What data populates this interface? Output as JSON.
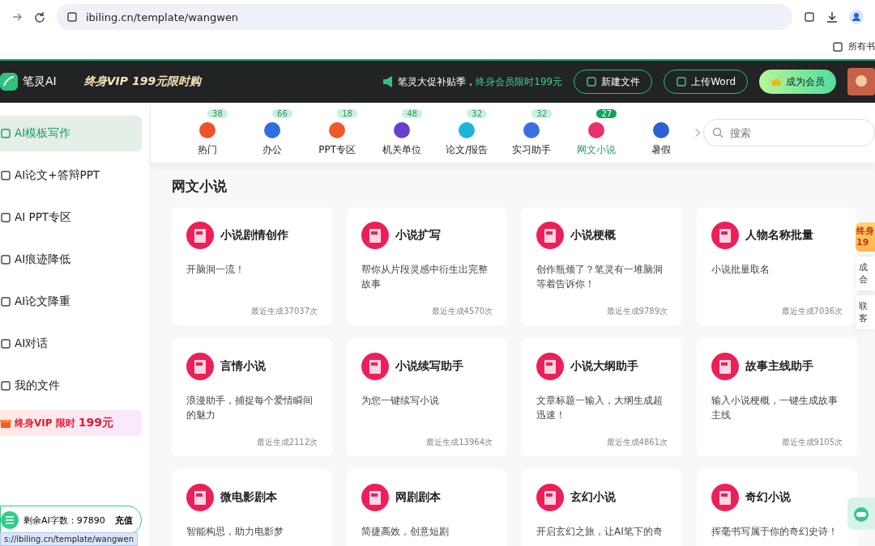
{
  "browser": {
    "url": "ibiling.cn/template/wangwen",
    "bookmark": "所有书"
  },
  "header": {
    "logo": "笔灵AI",
    "promo": "终身VIP 199元限时购",
    "notice": "笔灵大促补贴季，",
    "notice_highlight": "终身会员限时199元",
    "buttons": [
      {
        "label": "新建文件",
        "kind": "outline"
      },
      {
        "label": "上传Word",
        "kind": "outline"
      },
      {
        "label": "成为会员",
        "kind": "vip"
      }
    ]
  },
  "sidebar": {
    "items": [
      {
        "label": "AI模板写作",
        "selected": true
      },
      {
        "label": "AI论文+答辩PPT",
        "selected": false
      },
      {
        "label": "AI PPT专区",
        "selected": false
      },
      {
        "label": "AI痕迹降低",
        "selected": false
      },
      {
        "label": "AI论文降重",
        "selected": false
      },
      {
        "label": "AI对话",
        "selected": false
      },
      {
        "label": "我的文件",
        "selected": false
      }
    ],
    "vip": {
      "label": "终身VIP 限时",
      "price": "199元"
    },
    "credits": {
      "label": "剩余AI字数：97890",
      "action": "充值"
    }
  },
  "categories": [
    {
      "label": "热门",
      "count": "38",
      "color": "#f0502a",
      "selected": false
    },
    {
      "label": "办公",
      "count": "66",
      "color": "#2f6fe0",
      "selected": false
    },
    {
      "label": "PPT专区",
      "count": "18",
      "color": "#f05a2a",
      "selected": false
    },
    {
      "label": "机关单位",
      "count": "48",
      "color": "#6a3fd0",
      "selected": false
    },
    {
      "label": "论文/报告",
      "count": "32",
      "color": "#1bb5d8",
      "selected": false
    },
    {
      "label": "实习助手",
      "count": "32",
      "color": "#3a6fe0",
      "selected": false
    },
    {
      "label": "网文小说",
      "count": "27",
      "color": "#e8306a",
      "selected": true
    },
    {
      "label": "暑假",
      "color": "#2f5fd0",
      "selected": false
    }
  ],
  "search": {
    "placeholder": "搜索"
  },
  "section_title": "网文小说",
  "cards": [
    {
      "title": "小说剧情创作",
      "desc": "开脑洞一流！",
      "count": "最近生成37037次"
    },
    {
      "title": "小说扩写",
      "desc": "帮你从片段灵感中衍生出完整故事",
      "count": "最近生成4570次"
    },
    {
      "title": "小说梗概",
      "desc": "创作瓶颈了？笔灵有一堆脑洞等着告诉你！",
      "count": "最近生成9789次"
    },
    {
      "title": "人物名称批量",
      "desc": "小说批量取名",
      "count": "最近生成7036次"
    },
    {
      "title": "言情小说",
      "desc": "浪漫助手，捕捉每个爱情瞬间的魅力",
      "count": "最近生成2112次"
    },
    {
      "title": "小说续写助手",
      "desc": "为您一键续写小说",
      "count": "最近生成13964次"
    },
    {
      "title": "小说大纲助手",
      "desc": "文章标题一输入，大纲生成超迅速！",
      "count": "最近生成4861次"
    },
    {
      "title": "故事主线助手",
      "desc": "输入小说梗概，一键生成故事主线",
      "count": "最近生成9105次"
    },
    {
      "title": "微电影剧本",
      "desc": "智能构思，助力电影梦"
    },
    {
      "title": "网剧剧本",
      "desc": "简捷高效，创意短剧"
    },
    {
      "title": "玄幻小说",
      "desc": "开启玄幻之旅，让AI笔下的奇"
    },
    {
      "title": "奇幻小说",
      "desc": "挥毫书写属于你的奇幻史诗！"
    }
  ],
  "side_float": {
    "promo": [
      "终身",
      "19"
    ],
    "items": [
      [
        "成",
        "会"
      ],
      [
        "联",
        "客"
      ]
    ]
  },
  "status_bar": "s://ibiling.cn/template/wangwen"
}
